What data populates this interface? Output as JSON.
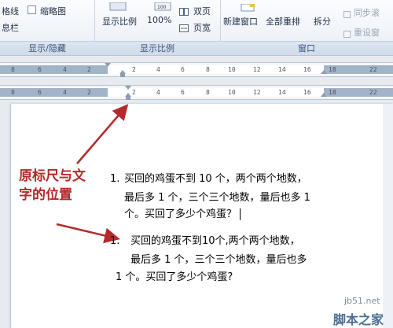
{
  "ribbon": {
    "show_group": {
      "gridlines_label": "格线",
      "thumbnail_label": "缩略图",
      "infobar_label": "息栏",
      "group_label": "显示/隐藏"
    },
    "zoom_group": {
      "zoom_label": "显示比例",
      "percent_label": "100%",
      "two_pages_label": "双页",
      "page_width_label": "页宽",
      "group_label": "显示比例"
    },
    "window_group": {
      "new_window_label": "新建窗口",
      "arrange_all_label": "全部重排",
      "split_label": "拆分",
      "sync_scroll_label": "同步滚",
      "reset_position_label": "重设窗",
      "group_label": "窗口"
    }
  },
  "ruler_top": {
    "ticks": [
      "8",
      "6",
      "4",
      "2",
      "2",
      "4",
      "6",
      "8",
      "10",
      "12",
      "14",
      "16",
      "18",
      "22"
    ]
  },
  "ruler_bottom": {
    "ticks": [
      "8",
      "6",
      "4",
      "2",
      "2",
      "4",
      "6",
      "8",
      "10",
      "12",
      "14",
      "16",
      "18",
      "22"
    ]
  },
  "annotation": {
    "line1": "原标尺与文",
    "line2": "字的位置"
  },
  "paragraph1": {
    "number": "1.",
    "line1": "买回的鸡蛋不到 10 个，两个两个地数，",
    "line2": "最后多 1 个，三个三个地数，量后也多 1",
    "line3": "个。买回了多少个鸡蛋？"
  },
  "paragraph2": {
    "number": "1.",
    "line1": "买回的鸡蛋不到10个,两个两个地数，",
    "line2": "最后多 1 个，三个三个地数，量后也多",
    "line3": "1 个。买回了多少个鸡蛋?"
  },
  "watermark": {
    "site": "jb51.net",
    "name": "脚本之家"
  },
  "colors": {
    "annotation_red": "#b32a2a",
    "ribbon_label": "#35507a",
    "ruler_margin": "#a3b3c8"
  }
}
